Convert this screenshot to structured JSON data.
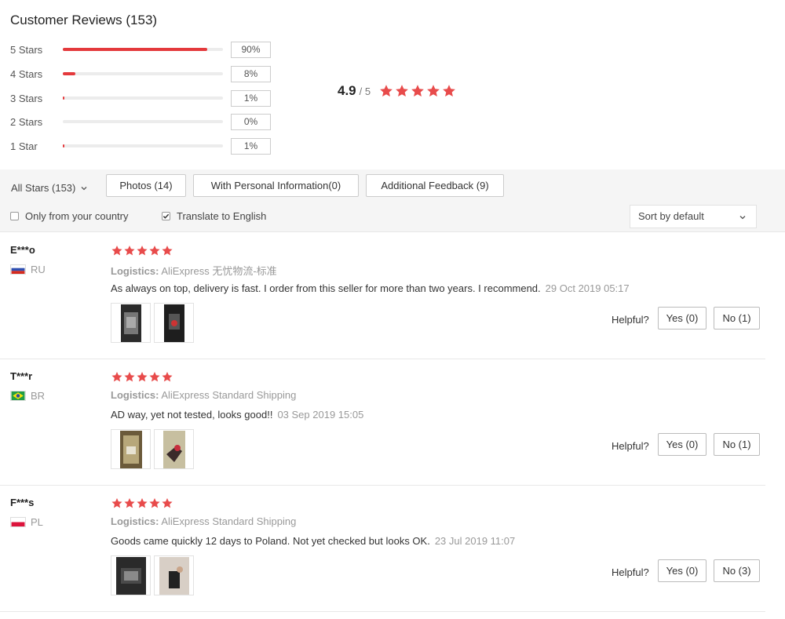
{
  "header": {
    "title": "Customer Reviews (153)"
  },
  "distribution": [
    {
      "label": "5 Stars",
      "pct": "90%",
      "value": 90
    },
    {
      "label": "4 Stars",
      "pct": "8%",
      "value": 8
    },
    {
      "label": "3 Stars",
      "pct": "1%",
      "value": 1
    },
    {
      "label": "2 Stars",
      "pct": "0%",
      "value": 0
    },
    {
      "label": "1 Star",
      "pct": "1%",
      "value": 1
    }
  ],
  "summary": {
    "average": "4.9",
    "outof": "/ 5",
    "stars": 5
  },
  "filters": {
    "all_stars": "All Stars (153)",
    "chips": [
      "Photos (14)",
      "With Personal Information(0)",
      "Additional Feedback (9)"
    ],
    "only_country": "Only from your country",
    "only_country_checked": false,
    "translate": "Translate to English",
    "translate_checked": true,
    "sort": "Sort by default"
  },
  "helpful_label": "Helpful?",
  "colors": {
    "accent": "#e4393c",
    "star": "#e84b4b"
  },
  "reviews": [
    {
      "user": "E***o",
      "country": "RU",
      "stars": 5,
      "logistics_label": "Logistics:",
      "logistics": "AliExpress 无忧物流-标准",
      "text": "As always on top, delivery is fast. I order from this seller for more than two years. I recommend.",
      "date": "29 Oct 2019 05:17",
      "yes": "Yes (0)",
      "no": "No (1)"
    },
    {
      "user": "T***r",
      "country": "BR",
      "stars": 5,
      "logistics_label": "Logistics:",
      "logistics": "AliExpress Standard Shipping",
      "text": "AD way, yet not tested, looks good!!",
      "date": "03 Sep 2019 15:05",
      "yes": "Yes (0)",
      "no": "No (1)"
    },
    {
      "user": "F***s",
      "country": "PL",
      "stars": 5,
      "logistics_label": "Logistics:",
      "logistics": "AliExpress Standard Shipping",
      "text": "Goods came quickly 12 days to Poland. Not yet checked but looks OK.",
      "date": "23 Jul 2019 11:07",
      "yes": "Yes (0)",
      "no": "No (3)"
    }
  ]
}
